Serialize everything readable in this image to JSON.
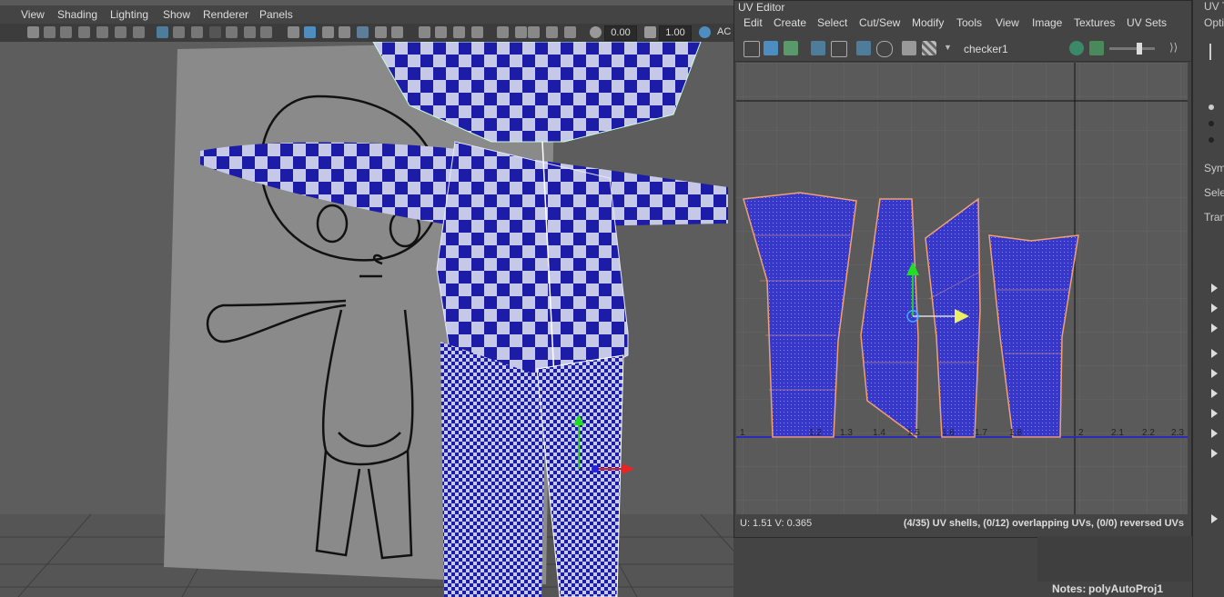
{
  "viewport": {
    "menus": [
      "View",
      "Shading",
      "Lighting",
      "Show",
      "Renderer",
      "Panels"
    ],
    "toolbar": {
      "field_a": "0.00",
      "field_b": "1.00",
      "trail_label": "AC"
    }
  },
  "uv_editor": {
    "title": "UV Editor",
    "menus": [
      "Edit",
      "Create",
      "Select",
      "Cut/Sew",
      "Modify",
      "Tools",
      "View",
      "Image",
      "Textures",
      "UV Sets"
    ],
    "texture_name": "checker1",
    "axis_labels": [
      "1",
      "1.2",
      "1.3",
      "1.4",
      "1.5",
      "1.6",
      "1.7",
      "1.8",
      "2",
      "2.1",
      "2.2",
      "2.3"
    ],
    "status_coords": "U:  1.51 V:  0.365",
    "status_info": "(4/35) UV shells, (0/12) overlapping UVs, (0/0) reversed UVs"
  },
  "right_panel": {
    "title": "UV T",
    "sub": "Opti",
    "labels": [
      "Symm",
      "Sele",
      "Tran"
    ]
  },
  "notes": {
    "label": "Notes:",
    "value": "polyAutoProj1"
  },
  "colors": {
    "checker_blue": "#1a1aa8",
    "checker_light": "#c8cbe6",
    "uv_shell_border": "#f0a070",
    "panel_bg": "#444444"
  }
}
